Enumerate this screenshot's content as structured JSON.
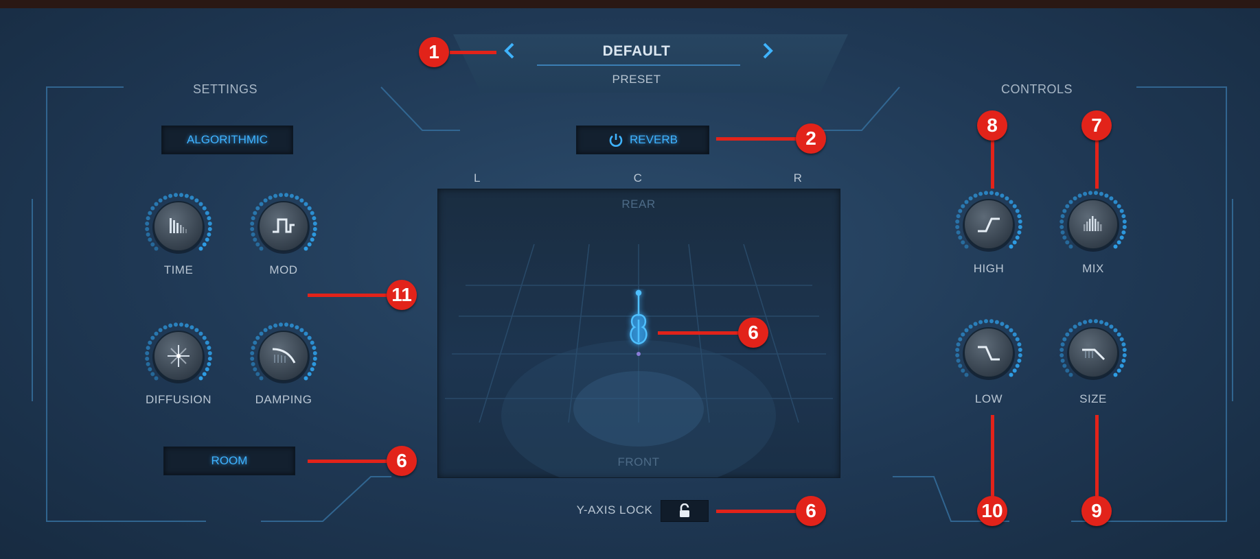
{
  "preset": {
    "name": "DEFAULT",
    "caption": "PRESET",
    "prev_icon": "chevron-left-icon",
    "next_icon": "chevron-right-icon"
  },
  "sections": {
    "settings": "SETTINGS",
    "controls": "CONTROLS"
  },
  "buttons": {
    "algorithm": "ALGORITHMIC",
    "reverb": "REVERB",
    "reverb_icon": "power-icon",
    "room": "ROOM"
  },
  "panner": {
    "left": "L",
    "center": "C",
    "right": "R",
    "rear": "REAR",
    "front": "FRONT",
    "source_icon": "violin-icon"
  },
  "y_axis_lock": {
    "label": "Y-AXIS LOCK",
    "icon": "lock-icon"
  },
  "knobs": {
    "time": "TIME",
    "mod": "MOD",
    "diffusion": "DIFFUSION",
    "damping": "DAMPING",
    "high": "HIGH",
    "mix": "MIX",
    "low": "LOW",
    "size": "SIZE"
  },
  "callouts": {
    "c1": "1",
    "c2": "2",
    "c6a": "6",
    "c6b": "6",
    "c6c": "6",
    "c7": "7",
    "c8": "8",
    "c9": "9",
    "c10": "10",
    "c11": "11"
  },
  "colors": {
    "accent": "#3fb3ff",
    "callout": "#e2231a",
    "background": "#1f3854"
  }
}
